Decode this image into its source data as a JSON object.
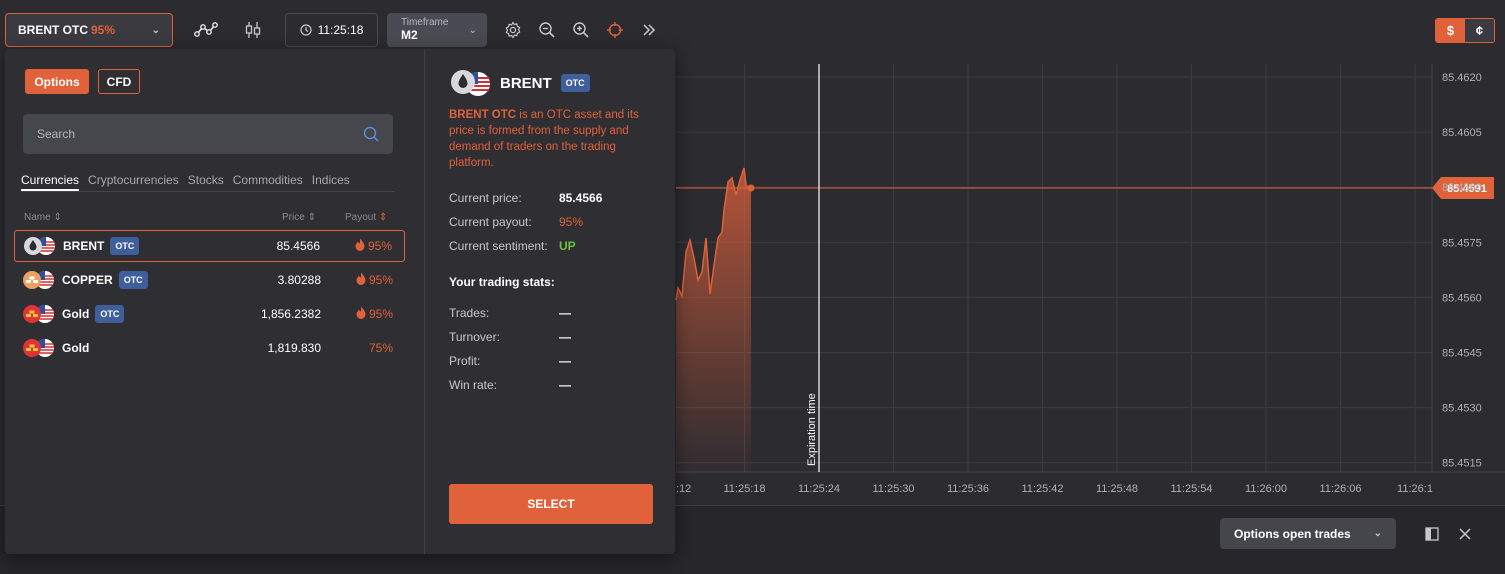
{
  "topbar": {
    "asset_name": "BRENT OTC",
    "asset_payout": "95%",
    "time": "11:25:18",
    "timeframe_label": "Timeframe",
    "timeframe_value": "M2",
    "currency_dollar": "$",
    "currency_cent": "¢"
  },
  "chart": {
    "current_price_label": "85.4591",
    "expiration_label": "Expiration time",
    "y_ticks": [
      "85.4620",
      "85.4605",
      "85.4590",
      "85.4575",
      "85.4560",
      "85.4545",
      "85.4530",
      "85.4515"
    ],
    "x_ticks": [
      ":12",
      "11:25:18",
      "11:25:24",
      "11:25:30",
      "11:25:36",
      "11:25:42",
      "11:25:48",
      "11:25:54",
      "11:26:00",
      "11:26:06",
      "11:26:1"
    ]
  },
  "bottombar": {
    "trades_label": "Options open trades"
  },
  "panel": {
    "type_options": "Options",
    "type_cfd": "CFD",
    "search_placeholder": "Search",
    "categories": [
      "Currencies",
      "Cryptocurrencies",
      "Stocks",
      "Commodities",
      "Indices"
    ],
    "col_name": "Name",
    "col_price": "Price",
    "col_payout": "Payout",
    "assets": [
      {
        "name": "BRENT",
        "otc": "OTC",
        "price": "85.4566",
        "payout": "95%"
      },
      {
        "name": "COPPER",
        "otc": "OTC",
        "price": "3.80288",
        "payout": "95%"
      },
      {
        "name": "Gold",
        "otc": "OTC",
        "price": "1,856.2382",
        "payout": "95%"
      },
      {
        "name": "Gold",
        "otc": "",
        "price": "1,819.830",
        "payout": "75%"
      }
    ],
    "detail": {
      "name": "BRENT",
      "otc": "OTC",
      "desc_bold": "BRENT OTC",
      "desc_rest": " is an OTC asset and its price is formed from the supply and demand of traders on the trading platform.",
      "current_price_label": "Current price:",
      "current_price": "85.4566",
      "current_payout_label": "Current payout:",
      "current_payout": "95%",
      "sentiment_label": "Current sentiment:",
      "sentiment": "UP",
      "stats_title": "Your trading stats:",
      "trades_label": "Trades:",
      "trades": "—",
      "turnover_label": "Turnover:",
      "turnover": "—",
      "profit_label": "Profit:",
      "profit": "—",
      "winrate_label": "Win rate:",
      "winrate": "—",
      "select_label": "SELECT"
    }
  },
  "colors": {
    "accent": "#e0623b",
    "otc_badge": "#3f5f9c",
    "sentiment_up": "#6fbf3f"
  }
}
